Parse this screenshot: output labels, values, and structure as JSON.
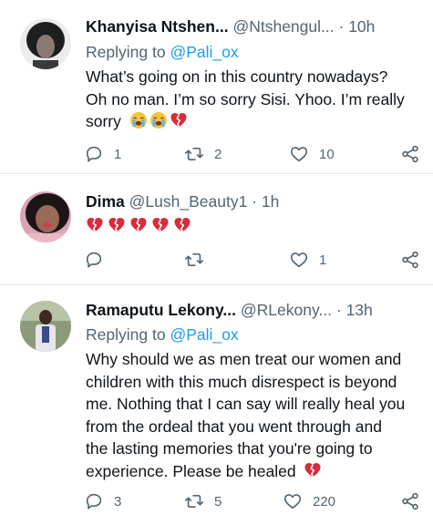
{
  "tweets": [
    {
      "name": "Khanyisa Ntshen...",
      "handle": "@Ntshengul...",
      "dot": "·",
      "time": "10h",
      "replying_to_label": "Replying to",
      "replying_to_mention": "@Pali_ox",
      "text_lines": [
        "What’s going on in this country nowadays?",
        "Oh no man. I’m so sorry Sisi. Yhoo. I’m really",
        "sorry"
      ],
      "emojis": [
        "loudly-crying-face",
        "loudly-crying-face",
        "broken-heart"
      ],
      "reply_count": "1",
      "retweet_count": "2",
      "like_count": "10"
    },
    {
      "name": "Dima",
      "handle": "@Lush_Beauty1",
      "dot": "·",
      "time": "1h",
      "emojis": [
        "broken-heart",
        "broken-heart",
        "broken-heart",
        "broken-heart",
        "broken-heart"
      ],
      "reply_count": "",
      "retweet_count": "",
      "like_count": "1"
    },
    {
      "name": "Ramaputu Lekony...",
      "handle": "@RLekony...",
      "dot": "·",
      "time": "13h",
      "replying_to_label": "Replying to",
      "replying_to_mention": "@Pali_ox",
      "text_lines": [
        "Why should we as men treat our women and",
        "children with this much disrespect is beyond",
        "me. Nothing that I can say will really heal you",
        "from the ordeal that you went through and",
        "the lasting memories that you're going to",
        "experience. Please be healed"
      ],
      "emojis": [
        "broken-heart"
      ],
      "reply_count": "3",
      "retweet_count": "5",
      "like_count": "220"
    }
  ],
  "colors": {
    "link": "#1d9bf0",
    "muted": "#536471",
    "text": "#0f1419",
    "divider": "#e6e9ec"
  }
}
